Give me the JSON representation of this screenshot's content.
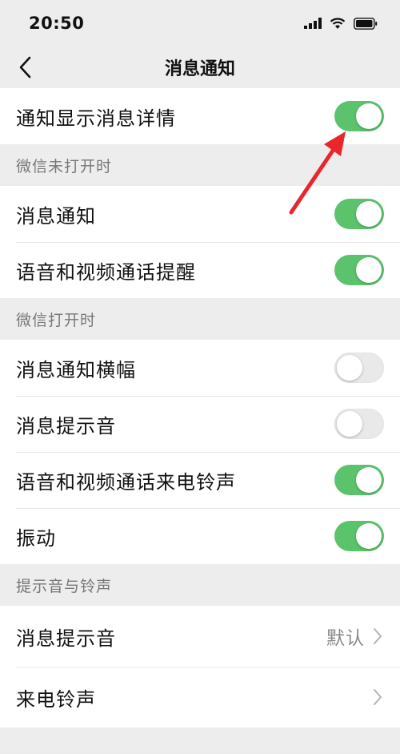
{
  "status_bar": {
    "time": "20:50"
  },
  "nav": {
    "title": "消息通知"
  },
  "top": {
    "detail_label": "通知显示消息详情",
    "detail_on": true
  },
  "section_closed": {
    "title": "微信未打开时",
    "items": [
      {
        "label": "消息通知",
        "on": true
      },
      {
        "label": "语音和视频通话提醒",
        "on": true
      }
    ]
  },
  "section_open": {
    "title": "微信打开时",
    "items": [
      {
        "label": "消息通知横幅",
        "on": false
      },
      {
        "label": "消息提示音",
        "on": false
      },
      {
        "label": "语音和视频通话来电铃声",
        "on": true
      },
      {
        "label": "振动",
        "on": true
      }
    ]
  },
  "section_sounds": {
    "title": "提示音与铃声",
    "items": [
      {
        "label": "消息提示音",
        "value": "默认"
      },
      {
        "label": "来电铃声",
        "value": ""
      }
    ]
  },
  "colors": {
    "toggle_on": "#5bc36c",
    "toggle_off": "#e9e9ea",
    "annotation_arrow": "#e8262b"
  }
}
